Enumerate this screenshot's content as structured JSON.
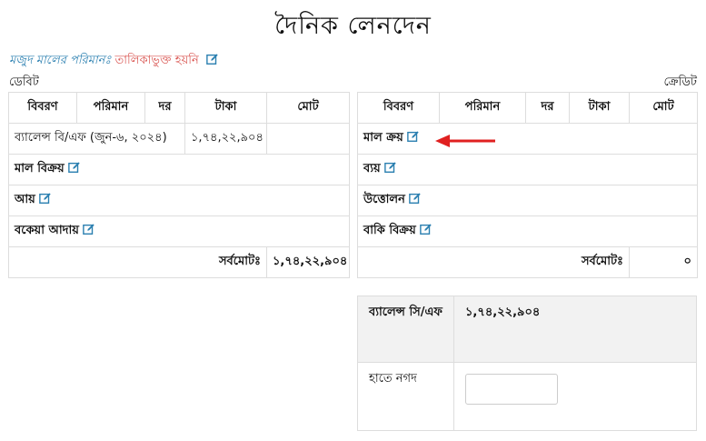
{
  "page": {
    "title": "দৈনিক লেনদেন",
    "stock_label": "মজুদ মালের পরিমানঃ",
    "stock_value": "তালিকাভুক্ত হয়নি",
    "debit_label": "ডেবিট",
    "credit_label": "ক্রেডিট"
  },
  "columns": {
    "description": "বিবরণ",
    "quantity": "পরিমান",
    "rate": "দর",
    "amount": "টাকা",
    "total": "মোট"
  },
  "debit": {
    "balance_bf": "ব্যালেন্স বি/এফ (জুন-৬, ২০২৪)",
    "balance_bf_amount": "১,৭৪,২২,৯০৪",
    "rows": [
      "মাল বিক্রয়",
      "আয়",
      "বকেয়া আদায়"
    ],
    "grand_total_label": "সর্বমোটঃ",
    "grand_total": "১,৭৪,২২,৯০৪"
  },
  "credit": {
    "rows": [
      "মাল ক্রয়",
      "ব্যয়",
      "উত্তোলন",
      "বাকি বিক্রয়"
    ],
    "grand_total_label": "সর্বমোটঃ",
    "grand_total": "০"
  },
  "balance": {
    "cf_label": "ব্যালেন্স সি/এফ",
    "cf_value": "১,৭৪,২২,৯০৪",
    "cash_label": "হাতে নগদ",
    "cash_value": ""
  },
  "colors": {
    "accent": "#2a7fb0",
    "warning": "#d9534f",
    "arrow": "#e02020",
    "border": "#dddddd"
  },
  "icons": {
    "edit": "edit-icon"
  }
}
